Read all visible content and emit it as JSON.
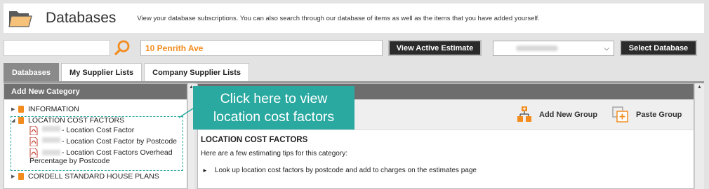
{
  "header": {
    "title": "Databases",
    "description": "View your database subscriptions. You can also search through our database of items as well as the items that you have added yourself."
  },
  "search": {
    "value": "",
    "address": "10 Penrith Ave"
  },
  "buttons": {
    "view_estimate": "View Active Estimate",
    "select_database": "Select Database"
  },
  "database_select": {
    "selected": ""
  },
  "tabs": [
    {
      "label": "Databases",
      "active": true
    },
    {
      "label": "My Supplier Lists",
      "active": false
    },
    {
      "label": "Company Supplier Lists",
      "active": false
    }
  ],
  "left_panel": {
    "header": "Add New Category",
    "tree": {
      "information": "INFORMATION",
      "location_cost_factors": "LOCATION COST FACTORS",
      "children": [
        {
          "label": "- Location Cost Factor"
        },
        {
          "label": "- Location Cost Factor by Postcode"
        },
        {
          "label": "- Location Cost Factors Overhead",
          "label2": "Percentage by Postcode"
        }
      ],
      "cordell": "CORDELL STANDARD HOUSE PLANS"
    }
  },
  "toolbar": {
    "add_group": "Add New Group",
    "paste_group": "Paste Group"
  },
  "content": {
    "title": "LOCATION COST FACTORS",
    "tips": "Here are a few estimating tips for this category:",
    "item1": "Look up location cost factors by postcode and add to charges on the estimates page"
  },
  "callout": {
    "line1": "Click here to view",
    "line2": "location cost factors"
  },
  "colors": {
    "accent": "#f28c1e",
    "callout": "#2aa9a0",
    "dark_button": "#2b2b2b"
  }
}
